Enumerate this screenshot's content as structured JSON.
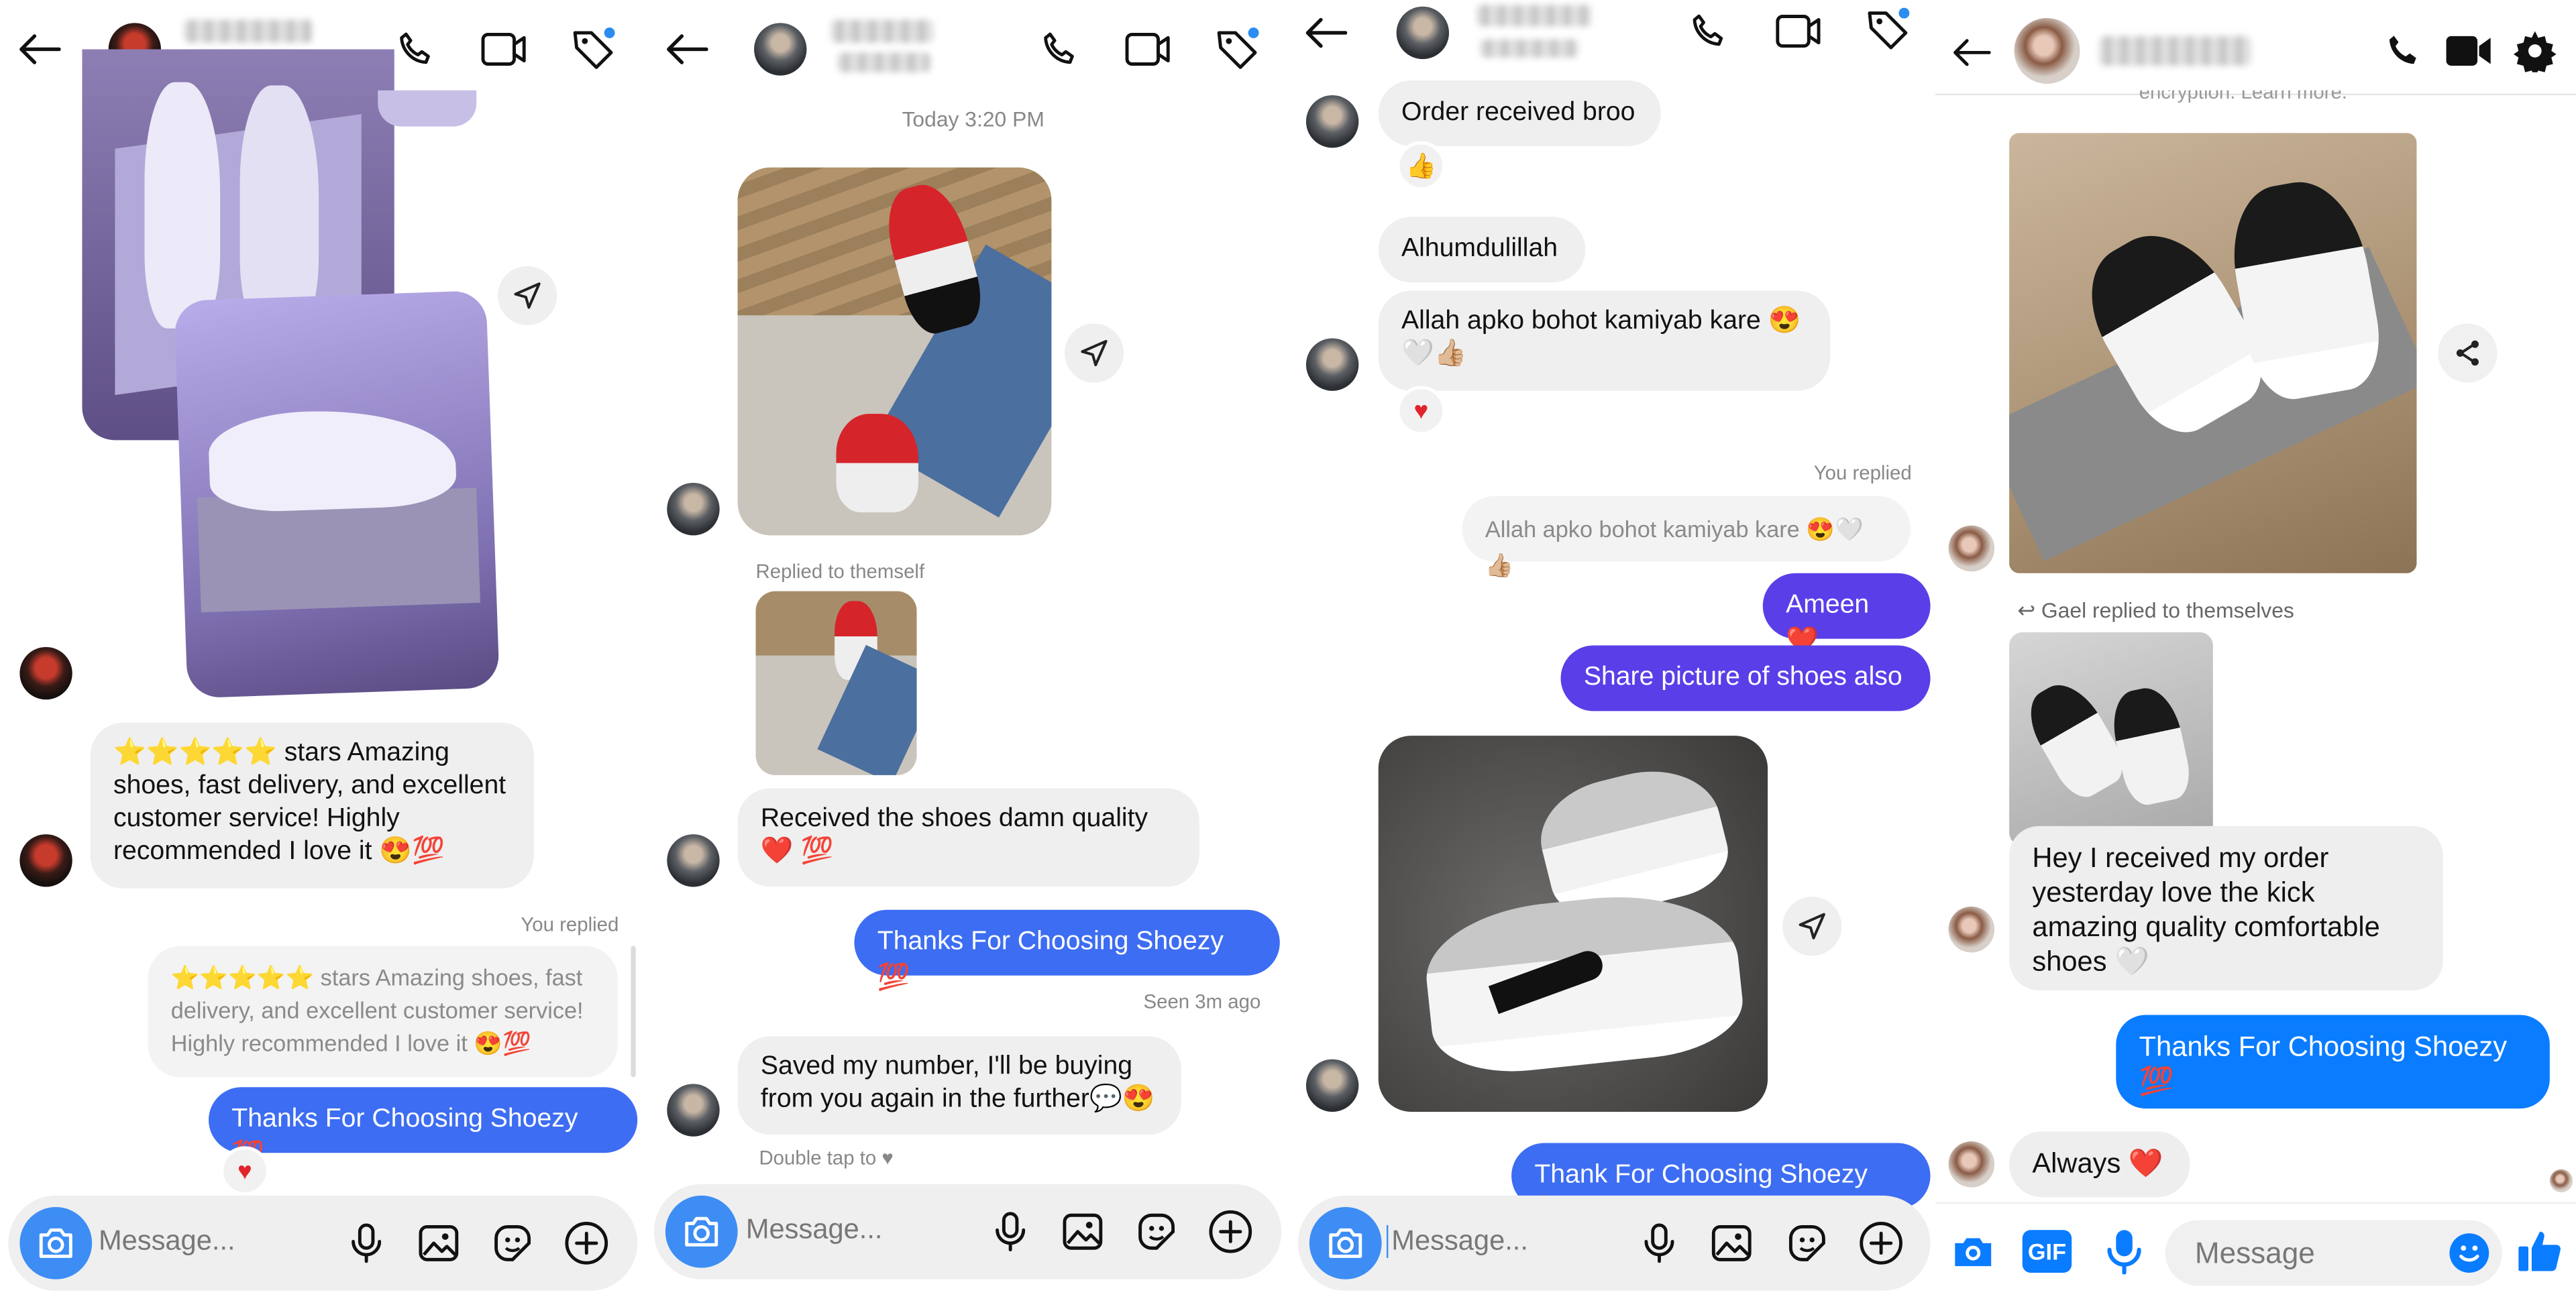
{
  "panels": [
    {
      "header": {
        "back_icon": "arrow-left-icon",
        "icons": [
          "phone-icon",
          "video-icon",
          "tag-icon"
        ]
      },
      "messages": {
        "review": "⭐⭐⭐⭐⭐ stars Amazing shoes, fast delivery, and excellent customer service! Highly recommended I love it 😍💯",
        "you_replied": "You replied",
        "quoted": "⭐⭐⭐⭐⭐ stars Amazing shoes, fast delivery, and excellent customer service! Highly recommended I love it 😍💯",
        "thanks": "Thanks For Choosing Shoezy 💯",
        "reaction": "♥"
      },
      "composer": {
        "placeholder": "Message..."
      }
    },
    {
      "header": {
        "back_icon": "arrow-left-icon",
        "icons": [
          "phone-icon",
          "video-icon",
          "tag-icon"
        ]
      },
      "messages": {
        "timestamp": "Today 3:20 PM",
        "replied_to": "Replied to themself",
        "received": "Received the shoes damn quality❤️ 💯",
        "thanks": "Thanks For Choosing Shoezy 💯",
        "seen": "Seen 3m ago",
        "saved": "Saved my number, I'll be buying from you again in the further💬😍",
        "double_tap": "Double tap to ♥"
      },
      "composer": {
        "placeholder": "Message..."
      }
    },
    {
      "header": {
        "back_icon": "arrow-left-icon",
        "icons": [
          "phone-icon",
          "video-icon",
          "tag-icon"
        ]
      },
      "messages": {
        "order": "Order received broo",
        "order_reaction": "👍",
        "alhumdulillah": "Alhumdulillah",
        "dua": "Allah apko bohot kamiyab kare 😍 🤍👍🏼",
        "dua_reaction": "♥",
        "you_replied": "You replied",
        "quoted": "Allah apko bohot kamiyab kare 😍🤍👍🏼",
        "ameen": "Ameen ❤️",
        "share": "Share picture of shoes also",
        "thank": "Thank For Choosing Shoezy 💯"
      },
      "composer": {
        "placeholder": "Message..."
      }
    },
    {
      "header": {
        "back_icon": "arrow-left-icon",
        "icons": [
          "phone-icon",
          "video-icon",
          "gear-icon"
        ]
      },
      "messages": {
        "top_fragment": "encryption. Learn more.",
        "replied_to": "Gael replied to themselves",
        "received": "Hey I received my order yesterday love the kick amazing quality comfortable shoes 🤍",
        "thanks": "Thanks For Choosing Shoezy 💯",
        "always": "Always ❤️"
      },
      "composer": {
        "placeholder": "Message",
        "gif_label": "GIF"
      }
    }
  ],
  "colors": {
    "ig_blue": "#3d6df2",
    "ig_purple": "#5a3ee8",
    "fb_blue": "#0a7cff",
    "bubble_gray": "#efefef"
  }
}
